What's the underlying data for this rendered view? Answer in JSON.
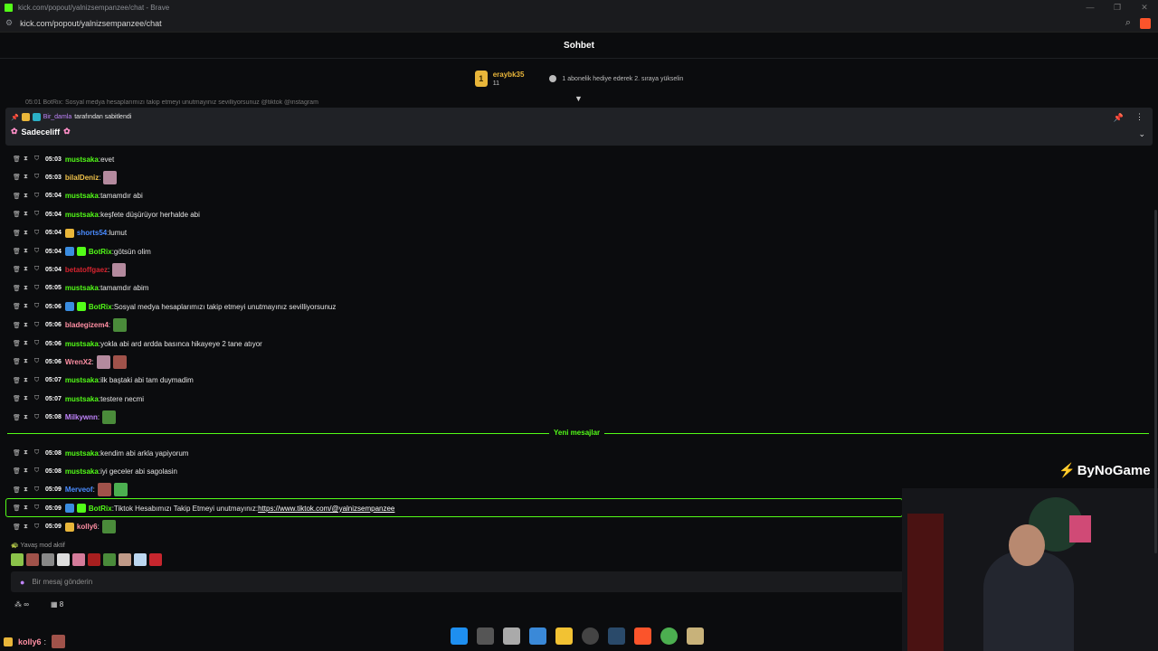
{
  "browser": {
    "title": "kick.com/popout/yalnizsempanzee/chat - Brave",
    "url": "kick.com/popout/yalnizsempanzee/chat",
    "window_controls": [
      "—",
      "❐",
      "✕"
    ]
  },
  "chat": {
    "header": "Sohbet",
    "sub_banner": {
      "rank": "1",
      "user": "eraybk35",
      "count": "11",
      "message": "1 abonelik hediye ederek 2. sıraya yükselin"
    },
    "hidden_line": "05:01 BotRix: Sosyal medya hesaplarımızı takip etmeyi unutmayınız sevilliyorsunuz @tiktok @instagram",
    "pinned": {
      "pinner": "Bir_damla",
      "by_text": "tarafından sabitlendi",
      "message": "Sadeceliff"
    },
    "messages": [
      {
        "time": "05:03",
        "user": "mustsaka",
        "color": "#53fc18",
        "text": "evet",
        "badges": [],
        "emotes": 0
      },
      {
        "time": "05:03",
        "user": "bilalDeniz",
        "color": "#f0c24a",
        "text": "",
        "badges": [],
        "emotes": 1
      },
      {
        "time": "05:04",
        "user": "mustsaka",
        "color": "#53fc18",
        "text": "tamamdır abi",
        "badges": [],
        "emotes": 0
      },
      {
        "time": "05:04",
        "user": "mustsaka",
        "color": "#53fc18",
        "text": "keşfete düşürüyor herhalde abi",
        "badges": [],
        "emotes": 0
      },
      {
        "time": "05:04",
        "user": "shorts54",
        "color": "#4a8cff",
        "text": "lumut",
        "badges": [
          "gold"
        ],
        "emotes": 0
      },
      {
        "time": "05:04",
        "user": "BotRix",
        "color": "#53fc18",
        "text": "götsün olim",
        "badges": [
          "blue",
          "green"
        ],
        "emotes": 0
      },
      {
        "time": "05:04",
        "user": "betatoffgaez",
        "color": "#d8242f",
        "text": "",
        "badges": [],
        "emotes": 1
      },
      {
        "time": "05:05",
        "user": "mustsaka",
        "color": "#53fc18",
        "text": "tamamdır abim",
        "badges": [],
        "emotes": 0
      },
      {
        "time": "05:06",
        "user": "BotRix",
        "color": "#53fc18",
        "text": "Sosyal medya hesaplarımızı takip etmeyi unutmayınız sevilliyorsunuz",
        "badges": [
          "blue",
          "green"
        ],
        "emotes": 0
      },
      {
        "time": "05:06",
        "user": "bladegizem4",
        "color": "#ff8fa3",
        "text": "",
        "badges": [],
        "emotes": 1
      },
      {
        "time": "05:06",
        "user": "mustsaka",
        "color": "#53fc18",
        "text": "yokla abi ard ardda basınca hikayeye 2 tane atıyor",
        "badges": [],
        "emotes": 0
      },
      {
        "time": "05:06",
        "user": "WrenX2",
        "color": "#ff8fa3",
        "text": "",
        "badges": [],
        "emotes": 2
      },
      {
        "time": "05:07",
        "user": "mustsaka",
        "color": "#53fc18",
        "text": "ilk baştaki abi tam duymadim",
        "badges": [],
        "emotes": 0
      },
      {
        "time": "05:07",
        "user": "mustsaka",
        "color": "#53fc18",
        "text": "testere necmi",
        "badges": [],
        "emotes": 0
      },
      {
        "time": "05:08",
        "user": "Milkywnn",
        "color": "#c084fc",
        "text": "",
        "badges": [],
        "emotes": 1
      },
      {
        "time": "05:08",
        "user": "mustsaka",
        "color": "#53fc18",
        "text": "kendim abi arkla yapiyorum",
        "badges": [],
        "emotes": 0
      },
      {
        "time": "05:08",
        "user": "mustsaka",
        "color": "#53fc18",
        "text": "iyi geceler abi sagolasin",
        "badges": [],
        "emotes": 0
      },
      {
        "time": "05:09",
        "user": "Merveof",
        "color": "#4a8cff",
        "text": "",
        "badges": [],
        "emotes": 2
      },
      {
        "time": "05:09",
        "user": "BotRix",
        "color": "#53fc18",
        "text": "Tiktok Hesabımızı Takip Etmeyi unutmayınız: ",
        "link": "https://www.tiktok.com/@yalnizsempanzee",
        "badges": [
          "blue",
          "green"
        ],
        "emotes": 0
      },
      {
        "time": "05:09",
        "user": "kolly6",
        "color": "#ff8fa3",
        "text": "",
        "badges": [
          "crown"
        ],
        "emotes": 1
      }
    ],
    "new_messages_label": "Yeni mesajlar",
    "slow_mode": "Yavaş mod aktif",
    "input_placeholder": "Bir mesaj gönderin",
    "footer": {
      "infinity": "∞",
      "gift_count": "8"
    }
  },
  "overlay": {
    "brand": "ByNoGame",
    "bottom_user": "kolly6"
  },
  "colors": {
    "accent": "#53fc18",
    "bg": "#0b0c0e",
    "pinned_bg": "#202226"
  }
}
